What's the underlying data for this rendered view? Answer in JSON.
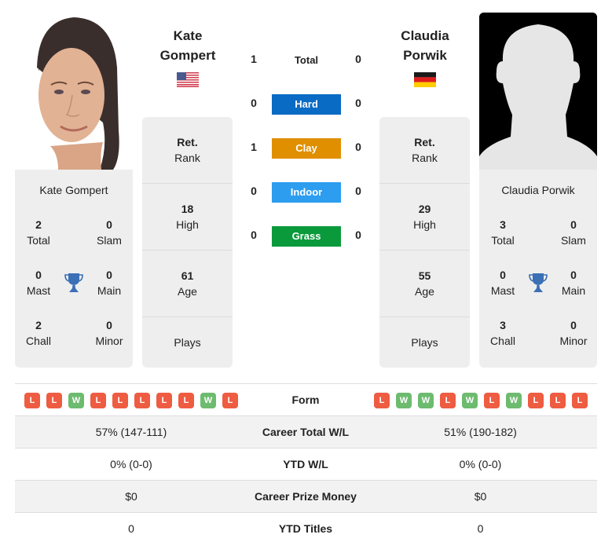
{
  "colors": {
    "hard": "#0a6bc4",
    "clay": "#e08f00",
    "indoor": "#2d9df0",
    "grass": "#0a9a3c",
    "loss": "#ee5c42",
    "win": "#6dbb6f",
    "trophy": "#3b6fb6"
  },
  "player1": {
    "name_line1": "Kate",
    "name_line2": "Gompert",
    "full_name": "Kate Gompert",
    "flag": "usa-flag",
    "rank_value": "Ret.",
    "rank_label": "Rank",
    "high_value": "18",
    "high_label": "High",
    "age_value": "61",
    "age_label": "Age",
    "plays_label": "Plays",
    "titles": {
      "total": "2",
      "total_label": "Total",
      "slam": "0",
      "slam_label": "Slam",
      "mast": "0",
      "mast_label": "Mast",
      "main": "0",
      "main_label": "Main",
      "chall": "2",
      "chall_label": "Chall",
      "minor": "0",
      "minor_label": "Minor"
    },
    "form": [
      "L",
      "L",
      "W",
      "L",
      "L",
      "L",
      "L",
      "L",
      "W",
      "L"
    ],
    "career_wl": "57% (147-111)",
    "ytd_wl": "0% (0-0)",
    "prize_money": "$0",
    "ytd_titles": "0"
  },
  "player2": {
    "name_line1": "Claudia",
    "name_line2": "Porwik",
    "full_name": "Claudia Porwik",
    "flag": "germany-flag",
    "rank_value": "Ret.",
    "rank_label": "Rank",
    "high_value": "29",
    "high_label": "High",
    "age_value": "55",
    "age_label": "Age",
    "plays_label": "Plays",
    "titles": {
      "total": "3",
      "total_label": "Total",
      "slam": "0",
      "slam_label": "Slam",
      "mast": "0",
      "mast_label": "Mast",
      "main": "0",
      "main_label": "Main",
      "chall": "3",
      "chall_label": "Chall",
      "minor": "0",
      "minor_label": "Minor"
    },
    "form": [
      "L",
      "W",
      "W",
      "L",
      "W",
      "L",
      "W",
      "L",
      "L",
      "L"
    ],
    "career_wl": "51% (190-182)",
    "ytd_wl": "0% (0-0)",
    "prize_money": "$0",
    "ytd_titles": "0"
  },
  "h2h": {
    "total": {
      "label": "Total",
      "p1": "1",
      "p2": "0"
    },
    "hard": {
      "label": "Hard",
      "p1": "0",
      "p2": "0"
    },
    "clay": {
      "label": "Clay",
      "p1": "1",
      "p2": "0"
    },
    "indoor": {
      "label": "Indoor",
      "p1": "0",
      "p2": "0"
    },
    "grass": {
      "label": "Grass",
      "p1": "0",
      "p2": "0"
    }
  },
  "table": {
    "form_label": "Form",
    "career_label": "Career Total W/L",
    "ytd_label": "YTD W/L",
    "prize_label": "Career Prize Money",
    "titles_label": "YTD Titles"
  }
}
